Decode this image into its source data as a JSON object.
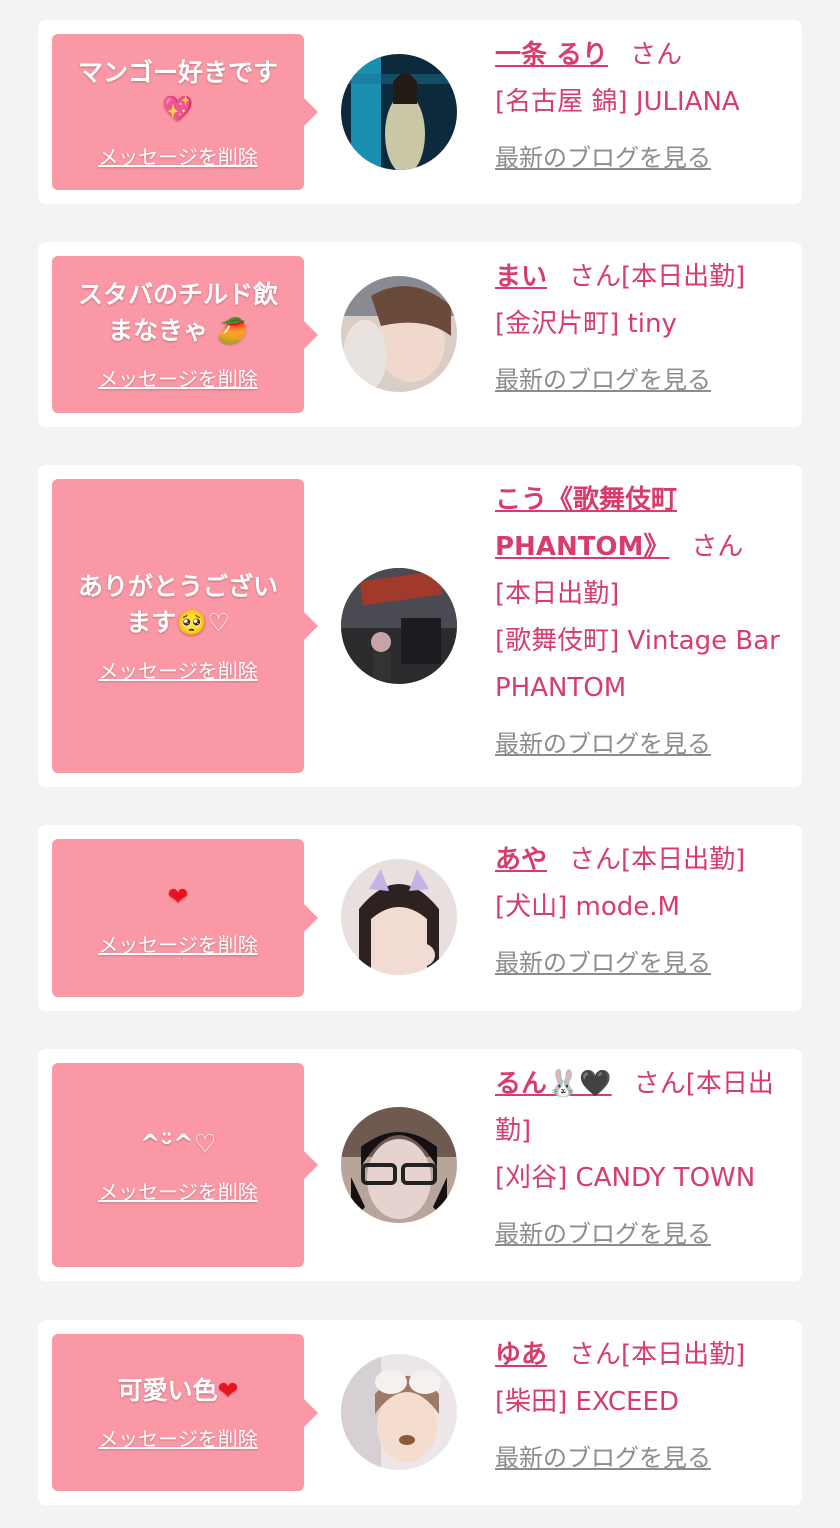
{
  "cards": [
    {
      "message": "マンゴー好きです",
      "message_icon": "sparkling-heart-icon",
      "delete_label": "メッセージを削除",
      "name": "一条 るり",
      "suffix": "さん",
      "status": "",
      "location": "[名古屋 錦] JULIANA",
      "blog_label": "最新のブログを見る",
      "avatar_icon": "profile-photo"
    },
    {
      "message": "スタバのチルド飲まなきゃ",
      "message_icon": "mango-emoji-icon",
      "delete_label": "メッセージを削除",
      "name": "まい",
      "suffix": "さん",
      "status": "[本日出勤]",
      "location": "[金沢片町] tiny",
      "blog_label": "最新のブログを見る",
      "avatar_icon": "profile-photo"
    },
    {
      "message": "ありがとうございます",
      "message_icon": "pleading-face-icon",
      "message_tail": "♡",
      "delete_label": "メッセージを削除",
      "name": "こう《歌舞伎町PHANTOM》",
      "suffix": "さん",
      "status": "[本日出勤]",
      "location": "[歌舞伎町] Vintage Bar PHANTOM",
      "blog_label": "最新のブログを見る",
      "avatar_icon": "profile-photo"
    },
    {
      "message": "",
      "message_icon": "red-heart-icon",
      "delete_label": "メッセージを削除",
      "name": "あや",
      "suffix": "さん",
      "status": "[本日出勤]",
      "location": "[犬山] mode.M",
      "blog_label": "最新のブログを見る",
      "avatar_icon": "profile-photo"
    },
    {
      "message": "^ᵕ̈^♡",
      "message_icon": "",
      "delete_label": "メッセージを削除",
      "name": "るん🐰🖤",
      "suffix": "さん",
      "status": "[本日出勤]",
      "location": "[刈谷] CANDY TOWN",
      "blog_label": "最新のブログを見る",
      "avatar_icon": "profile-photo"
    },
    {
      "message": "可愛い色",
      "message_icon": "red-heart-icon",
      "delete_label": "メッセージを削除",
      "name": "ゆあ",
      "suffix": "さん",
      "status": "[本日出勤]",
      "location": "[柴田] EXCEED",
      "blog_label": "最新のブログを見る",
      "avatar_icon": "profile-photo"
    }
  ],
  "colors": {
    "page_bg": "#f3f3f3",
    "bubble": "#fa98a6",
    "accent": "#d63d6c",
    "link_gray": "#8c8c8c"
  }
}
